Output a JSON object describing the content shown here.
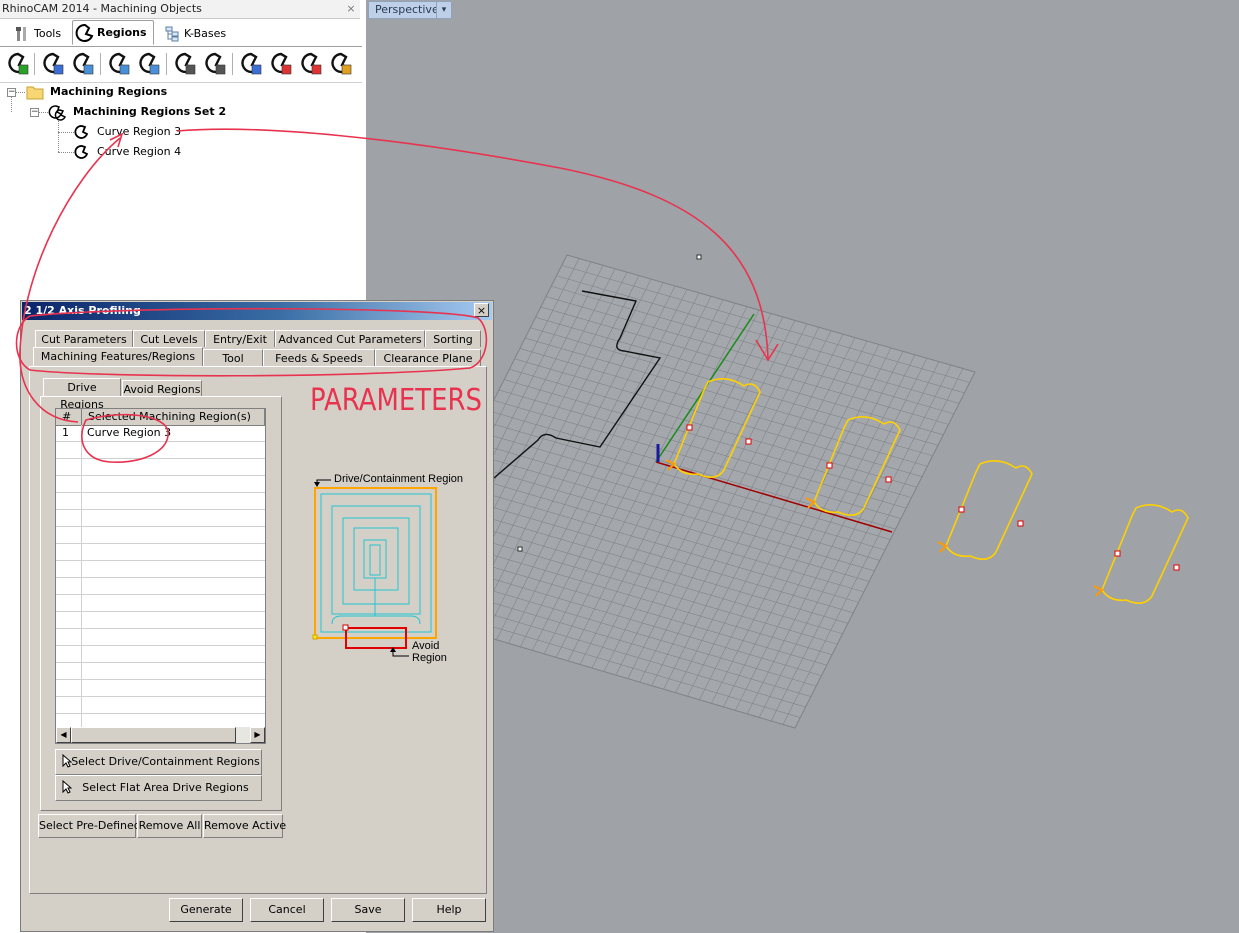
{
  "left_panel": {
    "title": "RhinoCAM 2014 - Machining Objects",
    "close": "×",
    "tabs": [
      {
        "label": "Tools"
      },
      {
        "label": "Regions"
      },
      {
        "label": "K-Bases"
      }
    ],
    "tree": {
      "root": "Machining Regions",
      "set": "Machining Regions Set 2",
      "items": [
        "Curve Region 3",
        "Curve Region 4"
      ],
      "minus": "−"
    }
  },
  "viewport": {
    "label": "Perspective",
    "arrow": "▾"
  },
  "dialog": {
    "title": "2 1/2 Axis Profiling",
    "close": "×",
    "tabs_row1": [
      "Cut Parameters",
      "Cut Levels",
      "Entry/Exit",
      "Advanced Cut Parameters",
      "Sorting"
    ],
    "tabs_row2": [
      "Machining Features/Regions",
      "Tool",
      "Feeds & Speeds",
      "Clearance Plane"
    ],
    "subtabs": [
      "Drive Regions",
      "Avoid Regions"
    ],
    "list": {
      "col_num": "#",
      "col_name": "Selected Machining Region(s)",
      "rows": [
        {
          "num": "1",
          "name": "Curve Region 3"
        }
      ]
    },
    "select_drive_button": "Select Drive/Containment Regions",
    "select_flat_button": "Select Flat Area Drive Regions",
    "select_predefined_button": "Select Pre-Defined",
    "remove_all_button": "Remove All",
    "remove_active_button": "Remove Active",
    "diagram": {
      "drive_label": "Drive/Containment Region",
      "avoid_label_1": "Avoid",
      "avoid_label_2": "Region"
    },
    "buttons": {
      "generate": "Generate",
      "cancel": "Cancel",
      "save": "Save",
      "help": "Help"
    }
  },
  "annotation": {
    "text": "PARAMETERS",
    "color": "#e8334f"
  },
  "colors": {
    "viewport_bg": "#9fa3a7",
    "grid": "#7f8489",
    "region_yellow": "#ffd000",
    "dialog_bg": "#d4d0c8"
  }
}
